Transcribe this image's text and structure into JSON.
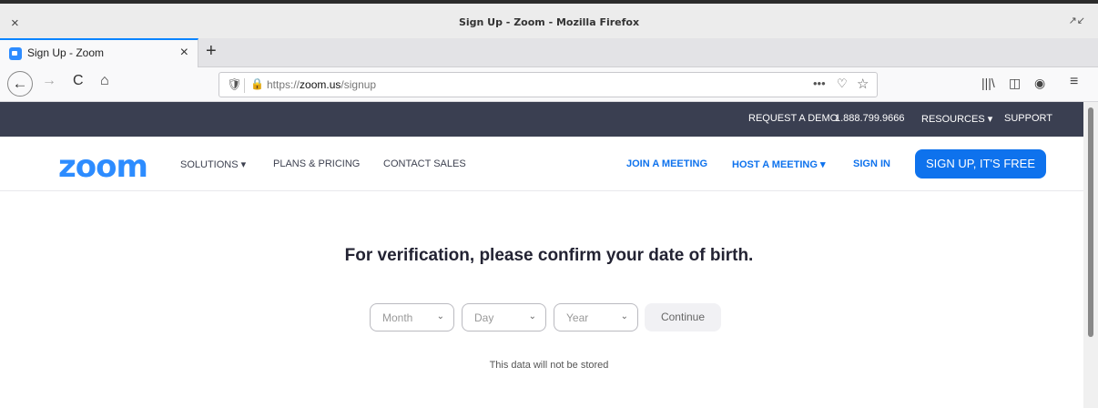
{
  "window": {
    "title": "Sign Up - Zoom - Mozilla Firefox",
    "close_glyph": "×",
    "restore_glyph": "↗↙"
  },
  "tabs": [
    {
      "label": "Sign Up - Zoom",
      "close_glyph": "×"
    }
  ],
  "new_tab_glyph": "+",
  "navbar": {
    "back_glyph": "←",
    "forward_glyph": "→",
    "reload_glyph": "C",
    "home_glyph": "⌂",
    "url_prefix": "https://",
    "url_host": "zoom.us",
    "url_path": "/signup",
    "more_glyph": "•••",
    "pocket_glyph": "♡",
    "star_glyph": "☆",
    "library_glyph": "|||\\",
    "sidebar_glyph": "◫",
    "account_glyph": "◉",
    "menu_glyph": "≡"
  },
  "topbar": {
    "request_demo": "REQUEST A DEMO",
    "phone": "1.888.799.9666",
    "resources": "RESOURCES ▾",
    "support": "SUPPORT"
  },
  "mainnav": {
    "logo": "zoom",
    "solutions": "SOLUTIONS ▾",
    "plans": "PLANS & PRICING",
    "contact": "CONTACT SALES",
    "join": "JOIN A MEETING",
    "host": "HOST A MEETING ▾",
    "signin": "SIGN IN",
    "signup": "SIGN UP, IT'S FREE"
  },
  "verification": {
    "heading": "For verification, please confirm your date of birth.",
    "month_placeholder": "Month",
    "day_placeholder": "Day",
    "year_placeholder": "Year",
    "continue_label": "Continue",
    "note": "This data will not be stored"
  },
  "colors": {
    "accent": "#0e72ed",
    "brand": "#2d8cff",
    "topbar": "#3a3f51"
  }
}
